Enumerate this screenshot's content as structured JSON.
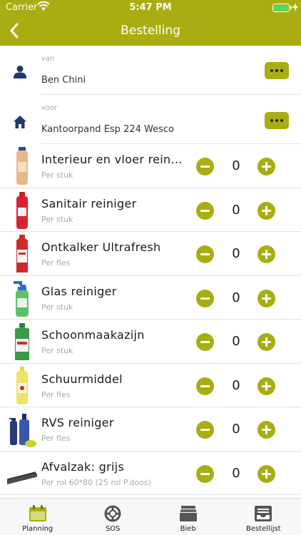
{
  "status_bar": {
    "carrier": "Carrier",
    "time": "5:47 PM"
  },
  "nav": {
    "title": "Bestelling",
    "back_icon": "chevron-left-icon"
  },
  "addresses": [
    {
      "label": "van",
      "value": "Ben Chini",
      "icon": "person-icon"
    },
    {
      "label": "voor",
      "value": "Kantoorpand Esp 224 Wesco",
      "icon": "home-icon"
    }
  ],
  "products": [
    {
      "name": "Interieur en vloer reiniger",
      "unit": "Per stuk",
      "qty": "0",
      "thumb": "bottle-beige"
    },
    {
      "name": "Sanitair reiniger",
      "unit": "Per stuk",
      "qty": "0",
      "thumb": "bottle-red"
    },
    {
      "name": "Ontkalker Ultrafresh",
      "unit": "Per fles",
      "qty": "0",
      "thumb": "bottle-red-white"
    },
    {
      "name": "Glas reiniger",
      "unit": "Per stuk",
      "qty": "0",
      "thumb": "spray-green"
    },
    {
      "name": "Schoonmaakazijn",
      "unit": "Per stuk",
      "qty": "0",
      "thumb": "jug-green"
    },
    {
      "name": "Schuurmiddel",
      "unit": "Per fles",
      "qty": "0",
      "thumb": "bottle-yellow"
    },
    {
      "name": "RVS reiniger",
      "unit": "Per fles",
      "qty": "0",
      "thumb": "spray-blue"
    },
    {
      "name": "Afvalzak: grijs",
      "unit": "Per rol 60*80 (25 rol P.doos)",
      "qty": "0",
      "thumb": "bag-roll"
    }
  ],
  "tabs": [
    {
      "label": "Planning",
      "icon": "calendar-icon"
    },
    {
      "label": "SOS",
      "icon": "lifebuoy-icon"
    },
    {
      "label": "Bieb",
      "icon": "books-icon"
    },
    {
      "label": "Bestellijst",
      "icon": "inbox-tray-icon"
    }
  ],
  "colors": {
    "accent": "#a9ad11",
    "background": "#ffffff",
    "text": "#1a1a1a",
    "muted": "#a8a8a8",
    "battery": "#4cd964"
  }
}
